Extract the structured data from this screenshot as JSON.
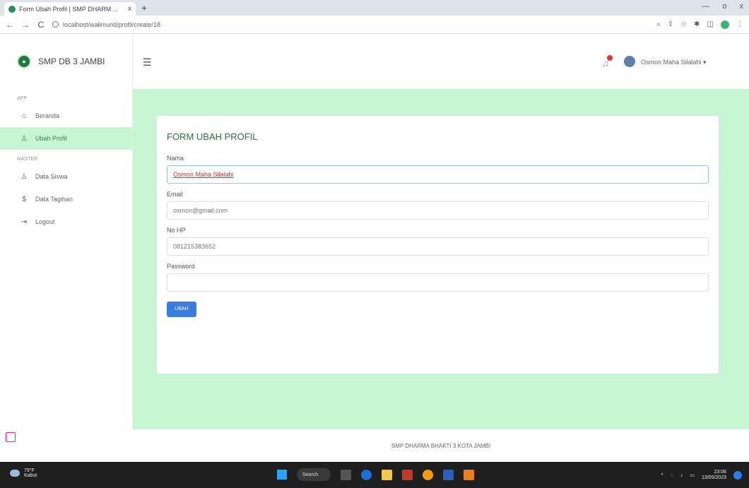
{
  "browser": {
    "tab_title": "Form Ubah Profil | SMP DHARM…",
    "tab_close": "x",
    "new_tab": "+",
    "url": "localhost/walimurid/profil/create/18",
    "controls": {
      "back": "←",
      "forward": "→",
      "reload": "C",
      "minimize": "—",
      "maximize": "o",
      "close": "x"
    }
  },
  "sidebar": {
    "brand": "SMP DB 3 JAMBI",
    "section_app": "APP",
    "section_master": "MASTER",
    "items": [
      {
        "label": "Beranda",
        "icon": "home-icon",
        "glyph": "⌂"
      },
      {
        "label": "Ubah Profil",
        "icon": "user-icon",
        "glyph": "♙"
      },
      {
        "label": "Data Siswa",
        "icon": "user-icon",
        "glyph": "♙"
      },
      {
        "label": "Data Tagihan",
        "icon": "dollar-icon",
        "glyph": "$"
      },
      {
        "label": "Logout",
        "icon": "logout-icon",
        "glyph": "⇥"
      }
    ]
  },
  "topbar": {
    "menu_glyph": "☰",
    "user_name": "Osmon Maha Silalahi ▾"
  },
  "form": {
    "title": "FORM UBAH PROFIL",
    "nama_label": "Nama",
    "nama_value": "Osmon Maha Silalahi",
    "email_label": "Email",
    "email_value": "osmon@gmail.com",
    "hp_label": "No HP",
    "hp_value": "081215383652",
    "password_label": "Password",
    "password_value": "",
    "submit_label": "UBAH"
  },
  "footer": {
    "text": "SMP DHARMA BHAKTI 3 KOTA JAMBI"
  },
  "taskbar": {
    "temperature": "79°F",
    "weather": "Kabut",
    "search": "Search",
    "time": "23:06",
    "date": "13/05/2023"
  },
  "colors": {
    "accent_green": "#c8f5d4",
    "primary_button": "#3b7ddd"
  }
}
